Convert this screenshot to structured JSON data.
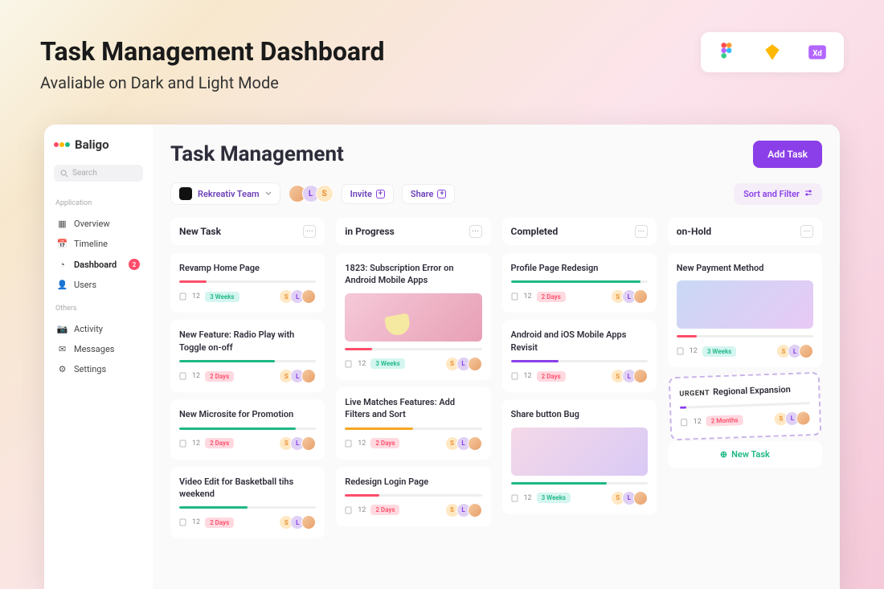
{
  "promo": {
    "title": "Task Management Dashboard",
    "subtitle": "Avaliable on Dark and Light Mode"
  },
  "brand": "Baligo",
  "search_placeholder": "Search",
  "sidebar": {
    "section1": "Application",
    "section2": "Others",
    "items1": [
      {
        "label": "Overview"
      },
      {
        "label": "Timeline"
      },
      {
        "label": "Dashboard",
        "badge": "2"
      },
      {
        "label": "Users"
      }
    ],
    "items2": [
      {
        "label": "Activity"
      },
      {
        "label": "Messages"
      },
      {
        "label": "Settings"
      }
    ]
  },
  "page": {
    "title": "Task Management",
    "add": "Add Task"
  },
  "toolbar": {
    "team": "Rekreativ Team",
    "invite": "Invite",
    "share": "Share",
    "sort": "Sort and Filter"
  },
  "columns": [
    {
      "title": "New Task",
      "cards": [
        {
          "title": "Revamp Home Page",
          "progress_color": "p-red",
          "progress": 20,
          "count": "12",
          "duration": "3 Weeks",
          "dur_cls": "d-teal"
        },
        {
          "title": "New Feature: Radio Play with Toggle on-off",
          "progress_color": "p-green",
          "progress": 70,
          "count": "12",
          "duration": "2 Days",
          "dur_cls": "d-pink"
        },
        {
          "title": "New Microsite for Promotion",
          "progress_color": "p-green",
          "progress": 85,
          "count": "12",
          "duration": "2 Days",
          "dur_cls": "d-pink"
        },
        {
          "title": "Video Edit for Basketball tihs weekend",
          "progress_color": "p-green",
          "progress": 50,
          "count": "12",
          "duration": "2 Days",
          "dur_cls": "d-pink"
        }
      ]
    },
    {
      "title": "in Progress",
      "cards": [
        {
          "title": "1823: Subscription Error on Android Mobile Apps",
          "thumb": "hand",
          "progress_color": "p-red",
          "progress": 20,
          "count": "12",
          "duration": "3 Weeks",
          "dur_cls": "d-teal"
        },
        {
          "title": "Live Matches Features: Add Filters and Sort",
          "progress_color": "p-orange",
          "progress": 50,
          "count": "12",
          "duration": "2 Days",
          "dur_cls": "d-pink"
        },
        {
          "title": "Redesign Login Page",
          "progress_color": "p-red",
          "progress": 25,
          "count": "12",
          "duration": "2 Days",
          "dur_cls": "d-pink"
        }
      ]
    },
    {
      "title": "Completed",
      "cards": [
        {
          "title": "Profile Page Redesign",
          "progress_color": "p-green",
          "progress": 95,
          "count": "12",
          "duration": "2 Days",
          "dur_cls": "d-pink"
        },
        {
          "title": "Android and iOS Mobile Apps Revisit",
          "progress_color": "p-purple",
          "progress": 35,
          "count": "12",
          "duration": "2 Days",
          "dur_cls": "d-pink"
        },
        {
          "title": "Share button Bug",
          "thumb": "marsh",
          "progress_color": "p-green",
          "progress": 70,
          "count": "12",
          "duration": "3 Weeks",
          "dur_cls": "d-teal"
        }
      ]
    },
    {
      "title": "on-Hold",
      "cards": [
        {
          "title": "New Payment Method",
          "thumb": "flowers",
          "progress_color": "p-red",
          "progress": 15,
          "count": "12",
          "duration": "3 Weeks",
          "dur_cls": "d-teal"
        },
        {
          "title": "Regional Expansion",
          "urgent": "URGENT",
          "progress_color": "p-purple",
          "progress": 5,
          "count": "12",
          "duration": "2 Months",
          "dur_cls": "d-pink"
        }
      ],
      "new_task": "New Task"
    }
  ]
}
